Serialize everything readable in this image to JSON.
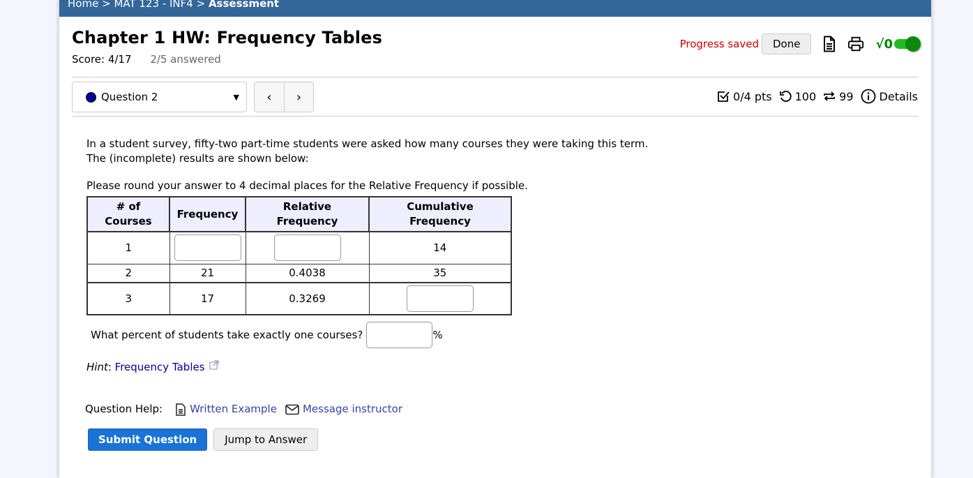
{
  "breadcrumb": {
    "items": [
      "Home",
      "MAT 123 - INF4",
      "Assessment"
    ],
    "separator": ">"
  },
  "header": {
    "title": "Chapter 1 HW: Frequency Tables",
    "score": "Score: 4/17",
    "answered": "2/5 answered",
    "progress_status": "Progress saved",
    "done_label": "Done",
    "math_toggle_label": "√0",
    "math_toggle_on": true
  },
  "question_nav": {
    "selected": "Question 2",
    "prev_label": "‹",
    "next_label": "›"
  },
  "question_stats": {
    "points": "0/4 pts",
    "attempts": "100",
    "versions": "99",
    "details_label": "Details"
  },
  "question": {
    "intro_line1": "In a student survey, fifty-two part-time students were asked how many courses they were taking this term.",
    "intro_line2": "The (incomplete) results are shown below:",
    "instruction": "Please round your answer to 4 decimal places for the Relative Frequency if possible.",
    "table": {
      "headers": [
        "# of Courses",
        "Frequency",
        "Relative Frequency",
        "Cumulative Frequency"
      ],
      "rows": [
        {
          "courses": "1",
          "frequency": "",
          "relative": "",
          "cumulative": "14"
        },
        {
          "courses": "2",
          "frequency": "21",
          "relative": "0.4038",
          "cumulative": "35"
        },
        {
          "courses": "3",
          "frequency": "17",
          "relative": "0.3269",
          "cumulative": ""
        }
      ]
    },
    "percent_prompt": "What percent of students take exactly one courses?",
    "percent_value": "",
    "percent_suffix": "%",
    "hint_label": "Hint",
    "hint_link": "Frequency Tables"
  },
  "help": {
    "label": "Question Help:",
    "written_example": "Written Example",
    "message_instructor": "Message instructor"
  },
  "actions": {
    "submit_label": "Submit Question",
    "jump_label": "Jump to Answer"
  },
  "colors": {
    "topbar": "#336699",
    "progress_saved": "#cc0000",
    "submit": "#1a73d6",
    "toggle": "#22bb22"
  }
}
